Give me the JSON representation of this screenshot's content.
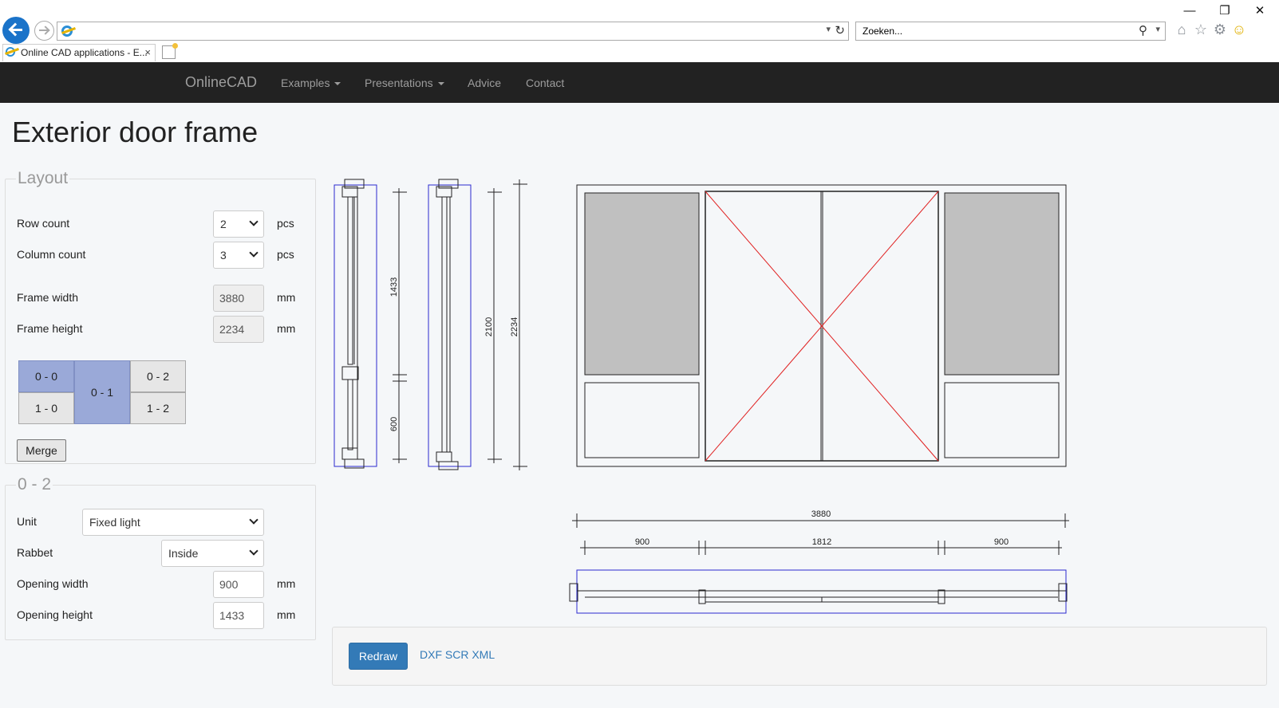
{
  "browser": {
    "search_placeholder": "Zoeken...",
    "tab_title": "Online CAD applications - E...",
    "tab_close": "×",
    "window_controls": {
      "minimize": "—",
      "restore": "❐",
      "close": "✕"
    },
    "icons": [
      "back-icon",
      "forward-icon",
      "ie-icon",
      "refresh-icon",
      "search-icon",
      "home-icon",
      "star-icon",
      "gear-icon",
      "smiley-icon"
    ]
  },
  "navbar": {
    "brand": "OnlineCAD",
    "items": [
      "Examples",
      "Presentations",
      "Advice",
      "Contact"
    ]
  },
  "page": {
    "title": "Exterior door frame"
  },
  "layout": {
    "legend": "Layout",
    "row_count": {
      "label": "Row count",
      "value": "2",
      "unit": "pcs"
    },
    "column_count": {
      "label": "Column count",
      "value": "3",
      "unit": "pcs"
    },
    "frame_width": {
      "label": "Frame width",
      "value": "3880",
      "unit": "mm"
    },
    "frame_height": {
      "label": "Frame height",
      "value": "2234",
      "unit": "mm"
    },
    "cells": [
      "0 - 0",
      "0 - 1",
      "0 - 2",
      "1 - 0",
      "1 - 2"
    ],
    "merge_label": "Merge"
  },
  "cell": {
    "legend": "0 - 2",
    "unit": {
      "label": "Unit",
      "value": "Fixed light"
    },
    "rabbet": {
      "label": "Rabbet",
      "value": "Inside"
    },
    "opening_width": {
      "label": "Opening width",
      "value": "900",
      "unit": "mm"
    },
    "opening_height": {
      "label": "Opening height",
      "value": "1433",
      "unit": "mm"
    }
  },
  "drawing": {
    "section_dims": [
      "1433",
      "600",
      "2100",
      "2234"
    ],
    "plan_dims": [
      "3880",
      "900",
      "1812",
      "900"
    ],
    "colors": {
      "frame_outline": "#2a2ad0",
      "glass": "#c0c0c0",
      "door_cross": "#e02020"
    }
  },
  "actions": {
    "redraw_label": "Redraw",
    "export_links": "DXF SCR XML"
  },
  "colors": {
    "navbar_bg": "#222222",
    "primary": "#337ab7",
    "selected_cell": "#9aa9d8"
  }
}
